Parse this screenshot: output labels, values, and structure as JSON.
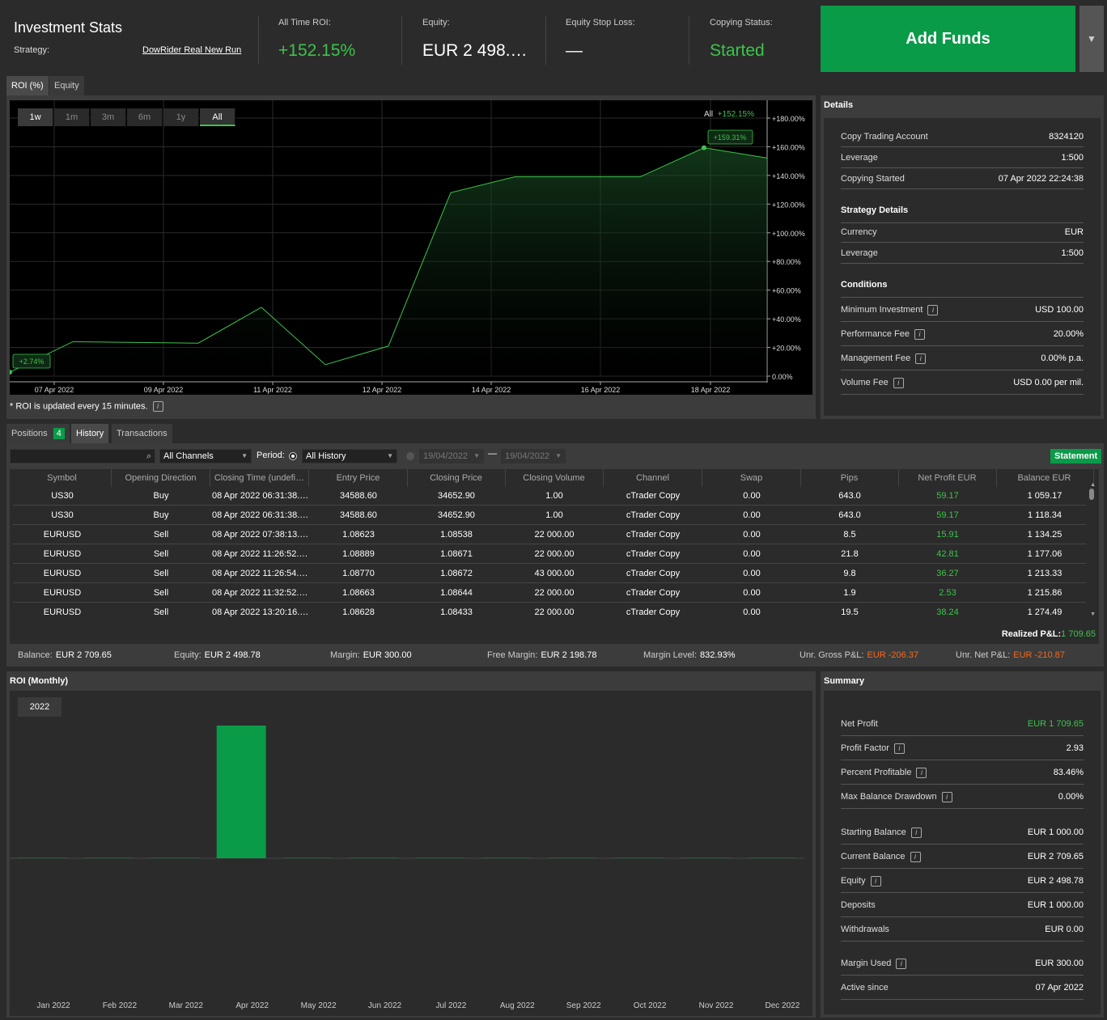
{
  "header": {
    "title": "Investment Stats",
    "strategy_label": "Strategy:",
    "strategy_name": "DowRider Real New Run",
    "roi_label": "All Time ROI:",
    "roi_value": "+152.15%",
    "equity_label": "Equity:",
    "equity_value": "EUR 2 498.…",
    "stoploss_label": "Equity Stop Loss:",
    "stoploss_value": "—",
    "status_label": "Copying Status:",
    "status_value": "Started",
    "add_funds": "Add Funds",
    "dropdown_icon": "▼"
  },
  "chart_tabs": {
    "roi": "ROI (%)",
    "equity": "Equity"
  },
  "ranges": [
    "1w",
    "1m",
    "3m",
    "6m",
    "1y",
    "All"
  ],
  "chart_legend": {
    "label": "All",
    "value": "+152.15%"
  },
  "chart_data": {
    "type": "area",
    "x": [
      "07 Apr 2022",
      "08 Apr 2022",
      "10 Apr 2022",
      "11 Apr 2022",
      "11 Apr 2022",
      "12 Apr 2022",
      "13 Apr 2022",
      "14 Apr 2022",
      "16 Apr 2022",
      "18 Apr 2022",
      "19 Apr 2022"
    ],
    "values": [
      2.74,
      24,
      23,
      48,
      8,
      21,
      128,
      139,
      139,
      159.31,
      152.15
    ],
    "x_ticks": [
      "07 Apr 2022",
      "09 Apr 2022",
      "11 Apr 2022",
      "12 Apr 2022",
      "14 Apr 2022",
      "16 Apr 2022",
      "18 Apr 2022"
    ],
    "y_ticks": [
      "+180.00%",
      "+160.00%",
      "+140.00%",
      "+120.00%",
      "+100.00%",
      "+80.00%",
      "+60.00%",
      "+40.00%",
      "+20.00%",
      "0.00%"
    ],
    "ylim": [
      0,
      180
    ],
    "start_label": "+2.74%",
    "peak_label": "+159.31%",
    "line_color": "#3cc44a"
  },
  "roi_note": "* ROI is updated every 15 minutes.",
  "details": {
    "title": "Details",
    "rows": [
      {
        "k": "Copy Trading Account",
        "v": "8324120"
      },
      {
        "k": "Leverage",
        "v": "1:500"
      },
      {
        "k": "Copying Started",
        "v": "07 Apr 2022 22:24:38"
      }
    ],
    "strategy_title": "Strategy Details",
    "strategy_rows": [
      {
        "k": "Currency",
        "v": "EUR"
      },
      {
        "k": "Leverage",
        "v": "1:500"
      }
    ],
    "conditions_title": "Conditions",
    "conditions_rows": [
      {
        "k": "Minimum Investment",
        "v": "USD 100.00"
      },
      {
        "k": "Performance Fee",
        "v": "20.00%"
      },
      {
        "k": "Management Fee",
        "v": "0.00% p.a."
      },
      {
        "k": "Volume Fee",
        "v": "USD 0.00 per mil."
      }
    ]
  },
  "lower_tabs": {
    "positions": "Positions",
    "positions_count": "4",
    "history": "History",
    "transactions": "Transactions"
  },
  "filters": {
    "channels": "All Channels",
    "period_label": "Period:",
    "period": "All History",
    "date_from": "19/04/2022",
    "date_sep": "—",
    "date_to": "19/04/2022",
    "statement": "Statement"
  },
  "table": {
    "columns": [
      "Symbol",
      "Opening Direction",
      "Closing Time (undefi…",
      "Entry Price",
      "Closing Price",
      "Closing Volume",
      "Channel",
      "Swap",
      "Pips",
      "Net Profit EUR",
      "Balance EUR"
    ],
    "rows": [
      [
        "US30",
        "Buy",
        "08 Apr 2022 06:31:38.…",
        "34588.60",
        "34652.90",
        "1.00",
        "cTrader Copy",
        "0.00",
        "643.0",
        "59.17",
        "1 059.17"
      ],
      [
        "US30",
        "Buy",
        "08 Apr 2022 06:31:38.…",
        "34588.60",
        "34652.90",
        "1.00",
        "cTrader Copy",
        "0.00",
        "643.0",
        "59.17",
        "1 118.34"
      ],
      [
        "EURUSD",
        "Sell",
        "08 Apr 2022 07:38:13.…",
        "1.08623",
        "1.08538",
        "22 000.00",
        "cTrader Copy",
        "0.00",
        "8.5",
        "15.91",
        "1 134.25"
      ],
      [
        "EURUSD",
        "Sell",
        "08 Apr 2022 11:26:52.…",
        "1.08889",
        "1.08671",
        "22 000.00",
        "cTrader Copy",
        "0.00",
        "21.8",
        "42.81",
        "1 177.06"
      ],
      [
        "EURUSD",
        "Sell",
        "08 Apr 2022 11:26:54.…",
        "1.08770",
        "1.08672",
        "43 000.00",
        "cTrader Copy",
        "0.00",
        "9.8",
        "36.27",
        "1 213.33"
      ],
      [
        "EURUSD",
        "Sell",
        "08 Apr 2022 11:32:52.…",
        "1.08663",
        "1.08644",
        "22 000.00",
        "cTrader Copy",
        "0.00",
        "1.9",
        "2.53",
        "1 215.86"
      ],
      [
        "EURUSD",
        "Sell",
        "08 Apr 2022 13:20:16.…",
        "1.08628",
        "1.08433",
        "22 000.00",
        "cTrader Copy",
        "0.00",
        "19.5",
        "38.24",
        "1 274.49"
      ]
    ],
    "realized_label": "Realized P&L:",
    "realized_value": "1 709.65"
  },
  "infobar": [
    {
      "k": "Balance:",
      "v": "EUR 2 709.65",
      "color": "#ffffff"
    },
    {
      "k": "Equity:",
      "v": "EUR 2 498.78",
      "color": "#ffffff"
    },
    {
      "k": "Margin:",
      "v": "EUR 300.00",
      "color": "#ffffff"
    },
    {
      "k": "Free Margin:",
      "v": "EUR 2 198.78",
      "color": "#ffffff"
    },
    {
      "k": "Margin Level:",
      "v": "832.93%",
      "color": "#ffffff"
    },
    {
      "k": "Unr. Gross P&L:",
      "v": "EUR -206.37",
      "color": "#f26a21"
    },
    {
      "k": "Unr. Net P&L:",
      "v": "EUR -210.87",
      "color": "#f26a21"
    }
  ],
  "monthly": {
    "title": "ROI (Monthly)",
    "year": "2022",
    "chart_data": {
      "type": "bar",
      "categories": [
        "Jan 2022",
        "Feb 2022",
        "Mar 2022",
        "Apr 2022",
        "May 2022",
        "Jun 2022",
        "Jul 2022",
        "Aug 2022",
        "Sep 2022",
        "Oct 2022",
        "Nov 2022",
        "Dec 2022"
      ],
      "values": [
        0,
        0,
        0,
        152.15,
        0,
        0,
        0,
        0,
        0,
        0,
        0,
        0
      ],
      "bar_color": "#0a9b48"
    }
  },
  "summary": {
    "title": "Summary",
    "rows": [
      {
        "k": "Net Profit",
        "v": "EUR 1 709.65",
        "info": false,
        "green": true
      },
      {
        "k": "Profit Factor",
        "v": "2.93",
        "info": true
      },
      {
        "k": "Percent Profitable",
        "v": "83.46%",
        "info": true
      },
      {
        "k": "Max Balance Drawdown",
        "v": "0.00%",
        "info": true
      }
    ],
    "rows2": [
      {
        "k": "Starting Balance",
        "v": "EUR 1 000.00",
        "info": true
      },
      {
        "k": "Current Balance",
        "v": "EUR 2 709.65",
        "info": true
      },
      {
        "k": "Equity",
        "v": "EUR 2 498.78",
        "info": true
      },
      {
        "k": "Deposits",
        "v": "EUR 1 000.00",
        "info": false
      },
      {
        "k": "Withdrawals",
        "v": "EUR 0.00",
        "info": false
      }
    ],
    "rows3": [
      {
        "k": "Margin Used",
        "v": "EUR 300.00",
        "info": true
      },
      {
        "k": "Active since",
        "v": "07 Apr 2022",
        "info": false
      }
    ]
  }
}
